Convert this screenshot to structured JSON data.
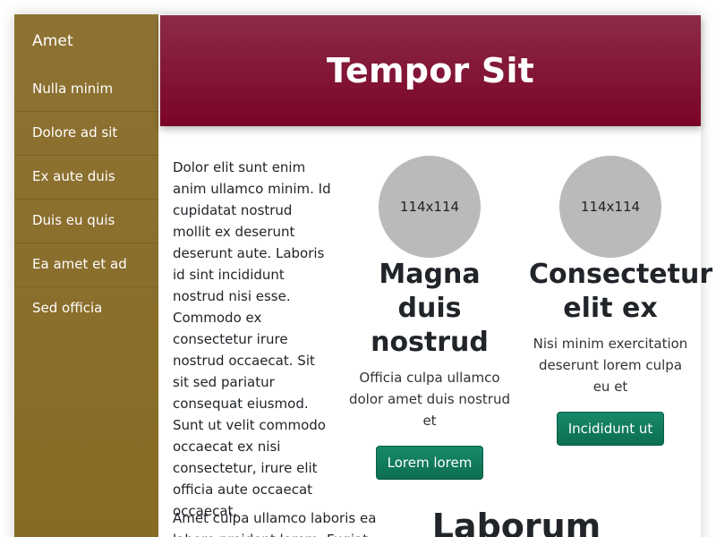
{
  "sidebar": {
    "brand": "Amet",
    "items": [
      {
        "label": "Nulla minim"
      },
      {
        "label": "Dolore ad sit"
      },
      {
        "label": "Ex aute duis"
      },
      {
        "label": "Duis eu quis"
      },
      {
        "label": "Ea amet et ad"
      },
      {
        "label": "Sed officia"
      }
    ]
  },
  "header": {
    "title": "Tempor Sit"
  },
  "intro": {
    "text": "Dolor elit sunt enim anim ullamco minim. Id cupidatat nostrud mollit ex deserunt deserunt aute. Laboris id sint incididunt nostrud nisi esse. Commodo ex consectetur irure nostrud occaecat. Sit sit sed pariatur consequat eiusmod. Sunt ut velit commodo occaecat ex nisi consectetur, irure elit officia aute occaecat occaecat."
  },
  "cards": [
    {
      "image_label": "114x114",
      "title": "Magna duis nostrud",
      "text": "Officia culpa ullamco dolor amet duis nostrud et",
      "button": "Lorem lorem"
    },
    {
      "image_label": "114x114",
      "title": "Consectetur elit ex",
      "text": "Nisi minim exercitation deserunt lorem culpa eu et",
      "button": "Incididunt ut"
    }
  ],
  "lower": {
    "text": "Amet culpa ullamco laboris ea labore proident lorem. Fugiat",
    "heading": "Laborum"
  },
  "colors": {
    "sidebar": "#876b24",
    "header": "#7a0327",
    "button": "#12795c"
  }
}
